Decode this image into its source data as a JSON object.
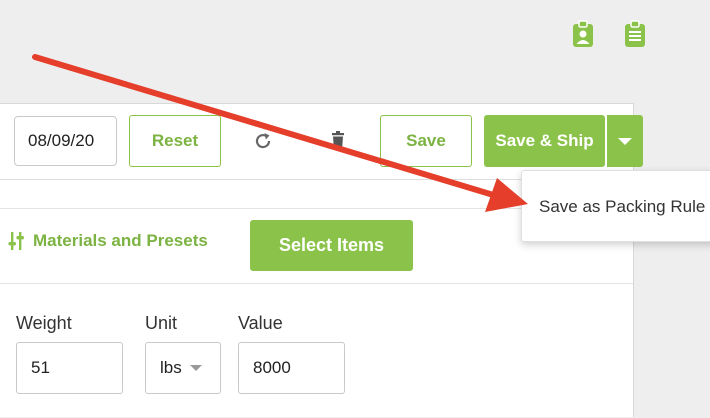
{
  "header": {
    "icons": [
      "id-badge-icon",
      "clipboard-icon"
    ]
  },
  "toolbar": {
    "date_value": "08/09/20",
    "reset_label": "Reset",
    "refresh_icon": "refresh-icon",
    "delete_icon": "trash-icon",
    "save_label": "Save",
    "save_ship_label": "Save & Ship",
    "dropdown_icon": "caret-down-icon"
  },
  "dropdown_menu": {
    "items": [
      {
        "label": "Save as Packing Rule"
      }
    ]
  },
  "materials": {
    "label": "Materials and Presets",
    "select_items_label": "Select Items"
  },
  "fields": {
    "weight": {
      "label": "Weight",
      "value": "51"
    },
    "unit": {
      "label": "Unit",
      "value": "lbs"
    },
    "value": {
      "label": "Value",
      "value": "8000"
    }
  },
  "colors": {
    "accent": "#8bc34a",
    "annotation_arrow": "#e53e2b"
  }
}
